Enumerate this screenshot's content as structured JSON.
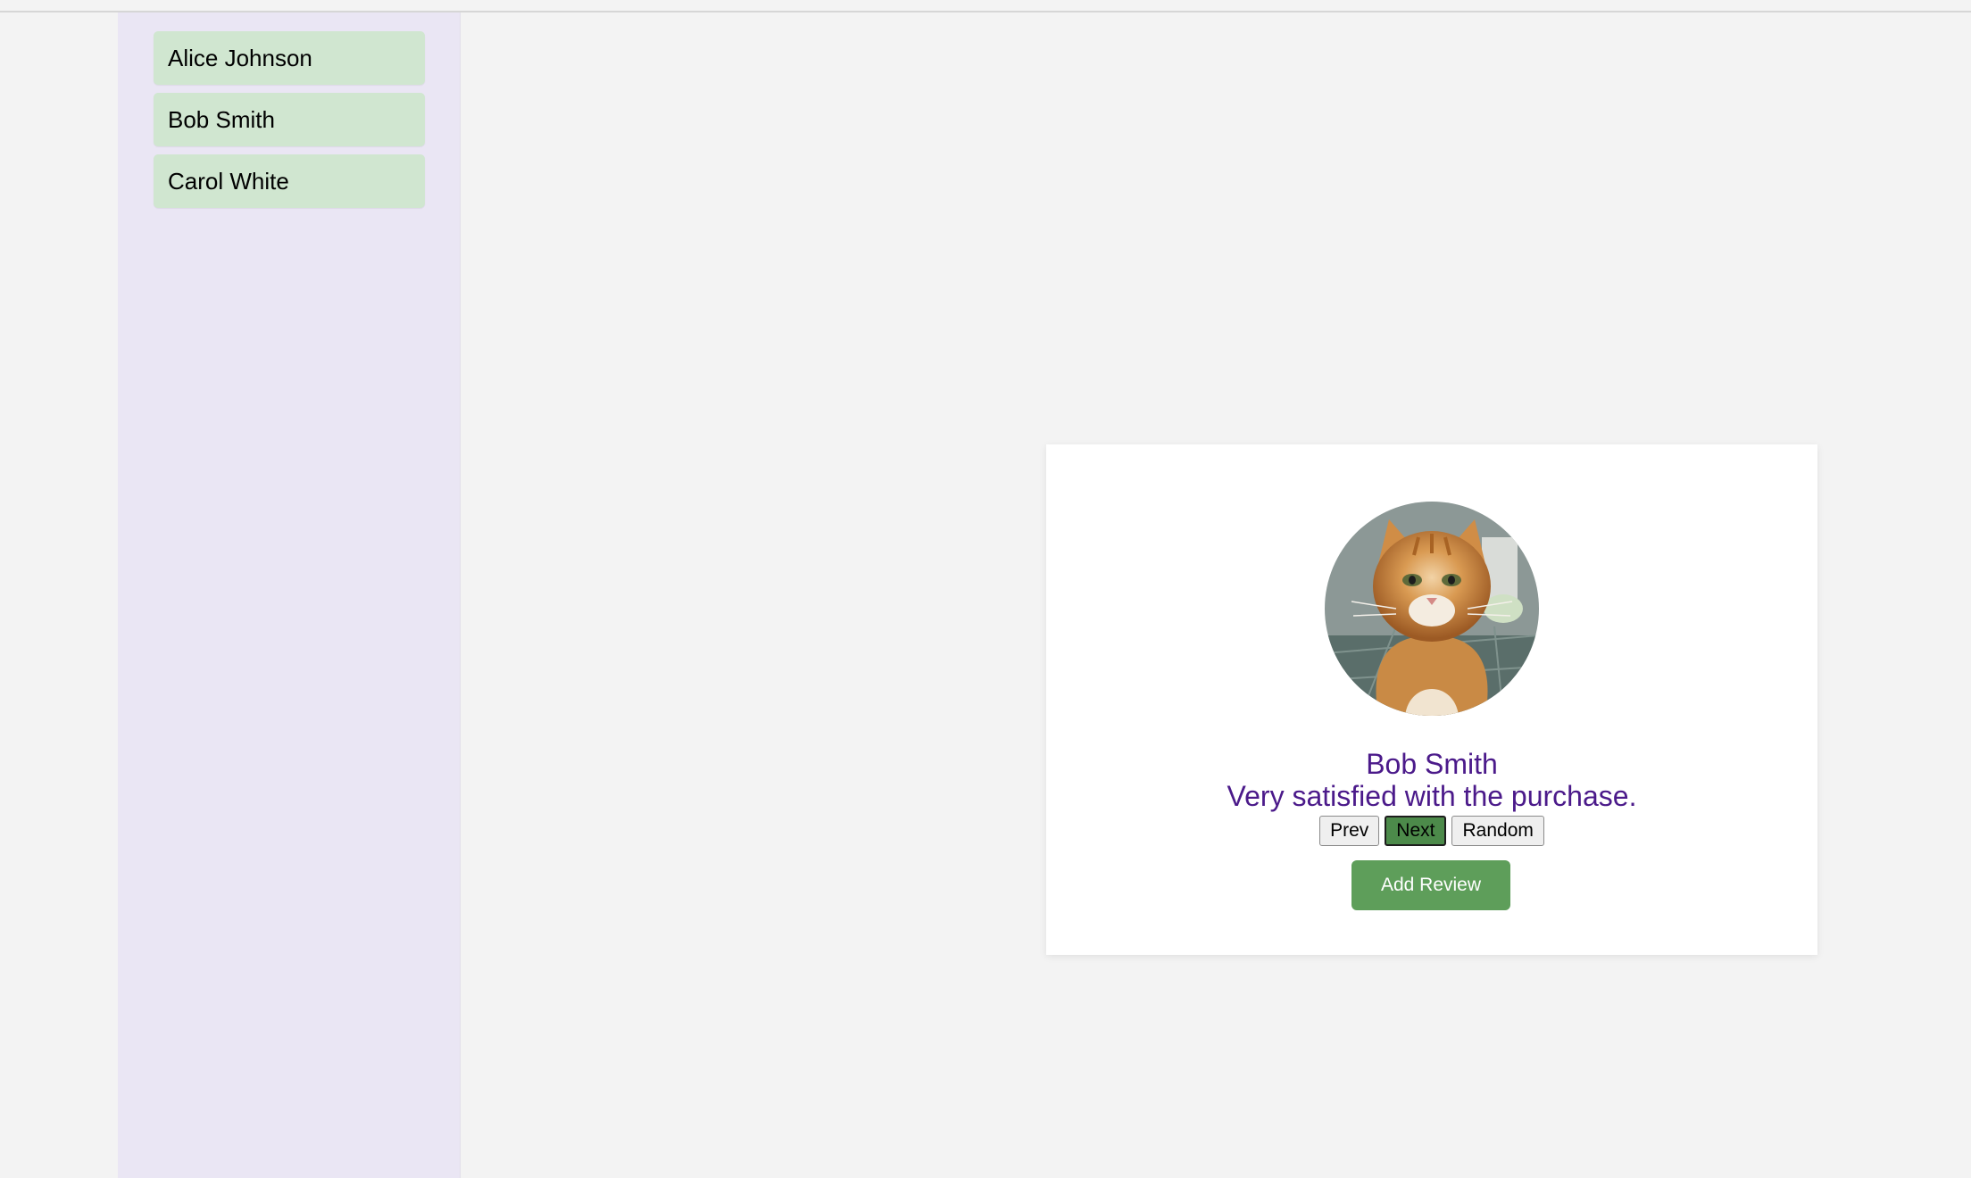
{
  "sidebar": {
    "items": [
      {
        "label": "Alice Johnson"
      },
      {
        "label": "Bob Smith"
      },
      {
        "label": "Carol White"
      }
    ]
  },
  "review": {
    "reviewer_name": "Bob Smith",
    "text": "Very satisfied with the purchase.",
    "avatar_icon": "cat-photo"
  },
  "controls": {
    "prev_label": "Prev",
    "next_label": "Next",
    "random_label": "Random",
    "active": "next",
    "add_review_label": "Add Review"
  },
  "colors": {
    "sidebar_bg": "#eae6f4",
    "sidebar_item_bg": "#d0e6d0",
    "name_text": "#4b1a8a",
    "add_button_bg": "#5e9e5a",
    "active_nav_bg": "#4c8a4a"
  }
}
